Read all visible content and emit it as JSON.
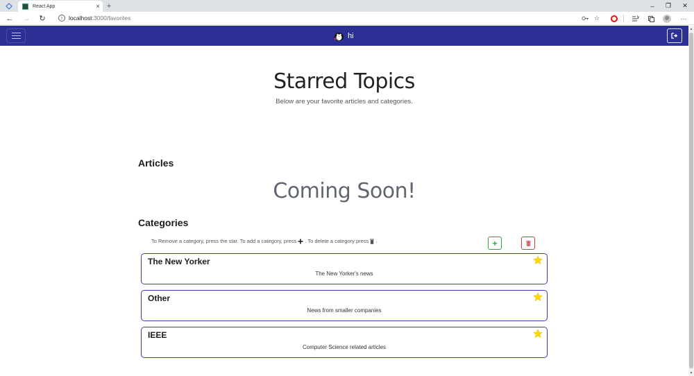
{
  "browser": {
    "tab_title": "React App",
    "tab_close": "×",
    "new_tab": "+",
    "url_host": "localhost",
    "url_path": ":3000/favorites",
    "minimize": "–",
    "restore": "❐",
    "close": "✕",
    "more": "···"
  },
  "navbar": {
    "brand_text": "hi",
    "bg_color": "#2c2f94"
  },
  "hero": {
    "title": "Starred Topics",
    "subtitle": "Below are your favorite articles and categories."
  },
  "articles": {
    "heading": "Articles",
    "placeholder": "Coming Soon!"
  },
  "categories": {
    "heading": "Categories",
    "instructions_1": "To Remove a category, press the star. To add a category, press",
    "instructions_2": ". To delete a category press",
    "instructions_3": ".",
    "add_label": "+",
    "items": [
      {
        "title": "The New Yorker",
        "description": "The New Yorker's news",
        "starred": true
      },
      {
        "title": "Other",
        "description": "News from smaller companies",
        "starred": true
      },
      {
        "title": "IEEE",
        "description": "Computer Science related articles",
        "starred": true
      }
    ]
  },
  "colors": {
    "accent": "#2c2f94",
    "add": "#28a745",
    "delete": "#dc3545",
    "star": "#ffd700"
  }
}
